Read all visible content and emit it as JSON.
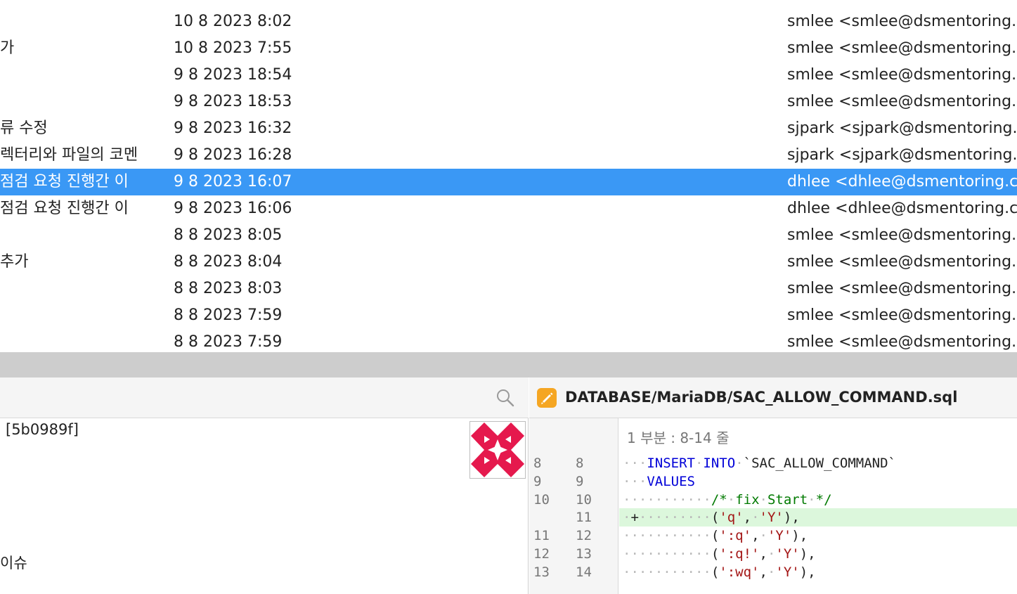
{
  "commit_list": {
    "rows": [
      {
        "message": "",
        "date": "10 8 2023 8:02",
        "author": "smlee <smlee@dsmentoring.c",
        "selected": false
      },
      {
        "message": "가",
        "date": "10 8 2023 7:55",
        "author": "smlee <smlee@dsmentoring.c",
        "selected": false
      },
      {
        "message": "",
        "date": "9 8 2023 18:54",
        "author": "smlee <smlee@dsmentoring.c",
        "selected": false
      },
      {
        "message": "",
        "date": "9 8 2023 18:53",
        "author": "smlee <smlee@dsmentoring.c",
        "selected": false
      },
      {
        "message": "류 수정",
        "date": "9 8 2023 16:32",
        "author": "sjpark <sjpark@dsmentoring.c",
        "selected": false
      },
      {
        "message": "렉터리와 파일의 코멘",
        "date": "9 8 2023 16:28",
        "author": "sjpark <sjpark@dsmentoring.c",
        "selected": false
      },
      {
        "message": " 점검 요청 진행간 이",
        "date": "9 8 2023 16:07",
        "author": "dhlee <dhlee@dsmentoring.co",
        "selected": true
      },
      {
        "message": " 점검 요청 진행간 이",
        "date": "9 8 2023 16:06",
        "author": "dhlee <dhlee@dsmentoring.co",
        "selected": false
      },
      {
        "message": "",
        "date": "8 8 2023 8:05",
        "author": "smlee <smlee@dsmentoring.c",
        "selected": false
      },
      {
        "message": "추가",
        "date": "8 8 2023 8:04",
        "author": "smlee <smlee@dsmentoring.c",
        "selected": false
      },
      {
        "message": "",
        "date": "8 8 2023 8:03",
        "author": "smlee <smlee@dsmentoring.c",
        "selected": false
      },
      {
        "message": "",
        "date": "8 8 2023 7:59",
        "author": "smlee <smlee@dsmentoring.c",
        "selected": false
      },
      {
        "message": "",
        "date": "8 8 2023 7:59",
        "author": "smlee <smlee@dsmentoring.c",
        "selected": false
      }
    ]
  },
  "detail": {
    "commit_hash": "[5b0989f]",
    "message_tail": "이슈",
    "search_icon": "search-icon",
    "avatar_colors": {
      "primary": "#e5194d",
      "secondary": "#ffffff"
    }
  },
  "diff": {
    "file_icon": "pencil-edit-icon",
    "file_path": "DATABASE/MariaDB/SAC_ALLOW_COMMAND.sql",
    "hunk_header": "1 부분 : 8-14 줄",
    "colors": {
      "added_bg": "#dcf7dc",
      "keyword": "#0000d8",
      "comment": "#007a00",
      "string": "#a31515"
    },
    "lines": [
      {
        "old": "8",
        "new": "8",
        "type": "context",
        "tokens": [
          [
            "ws",
            "···"
          ],
          [
            "kw",
            "INSERT"
          ],
          [
            "ws",
            "·"
          ],
          [
            "kw",
            "INTO"
          ],
          [
            "ws",
            "·"
          ],
          [
            "tx",
            "`SAC_ALLOW_COMMAND`"
          ]
        ]
      },
      {
        "old": "9",
        "new": "9",
        "type": "context",
        "tokens": [
          [
            "ws",
            "···"
          ],
          [
            "kw",
            "VALUES"
          ]
        ]
      },
      {
        "old": "10",
        "new": "10",
        "type": "context",
        "tokens": [
          [
            "ws",
            "···········"
          ],
          [
            "cm",
            "/*"
          ],
          [
            "ws",
            "·"
          ],
          [
            "cm",
            "fix"
          ],
          [
            "ws",
            "·"
          ],
          [
            "cm",
            "Start"
          ],
          [
            "ws",
            "·"
          ],
          [
            "cm",
            "*/"
          ]
        ]
      },
      {
        "old": "",
        "new": "11",
        "type": "added",
        "tokens": [
          [
            "ws",
            "·"
          ],
          [
            "plus",
            "+"
          ],
          [
            "ws",
            "·········"
          ],
          [
            "tx",
            "("
          ],
          [
            "st",
            "'q'"
          ],
          [
            "tx",
            ","
          ],
          [
            "ws",
            "·"
          ],
          [
            "st",
            "'Y'"
          ],
          [
            "tx",
            "),"
          ]
        ]
      },
      {
        "old": "11",
        "new": "12",
        "type": "context",
        "tokens": [
          [
            "ws",
            "···········"
          ],
          [
            "tx",
            "("
          ],
          [
            "st",
            "':q'"
          ],
          [
            "tx",
            ","
          ],
          [
            "ws",
            "·"
          ],
          [
            "st",
            "'Y'"
          ],
          [
            "tx",
            "),"
          ]
        ]
      },
      {
        "old": "12",
        "new": "13",
        "type": "context",
        "tokens": [
          [
            "ws",
            "···········"
          ],
          [
            "tx",
            "("
          ],
          [
            "st",
            "':q!'"
          ],
          [
            "tx",
            ","
          ],
          [
            "ws",
            "·"
          ],
          [
            "st",
            "'Y'"
          ],
          [
            "tx",
            "),"
          ]
        ]
      },
      {
        "old": "13",
        "new": "14",
        "type": "context",
        "tokens": [
          [
            "ws",
            "···········"
          ],
          [
            "tx",
            "("
          ],
          [
            "st",
            "':wq'"
          ],
          [
            "tx",
            ","
          ],
          [
            "ws",
            "·"
          ],
          [
            "st",
            "'Y'"
          ],
          [
            "tx",
            "),"
          ]
        ]
      }
    ]
  }
}
